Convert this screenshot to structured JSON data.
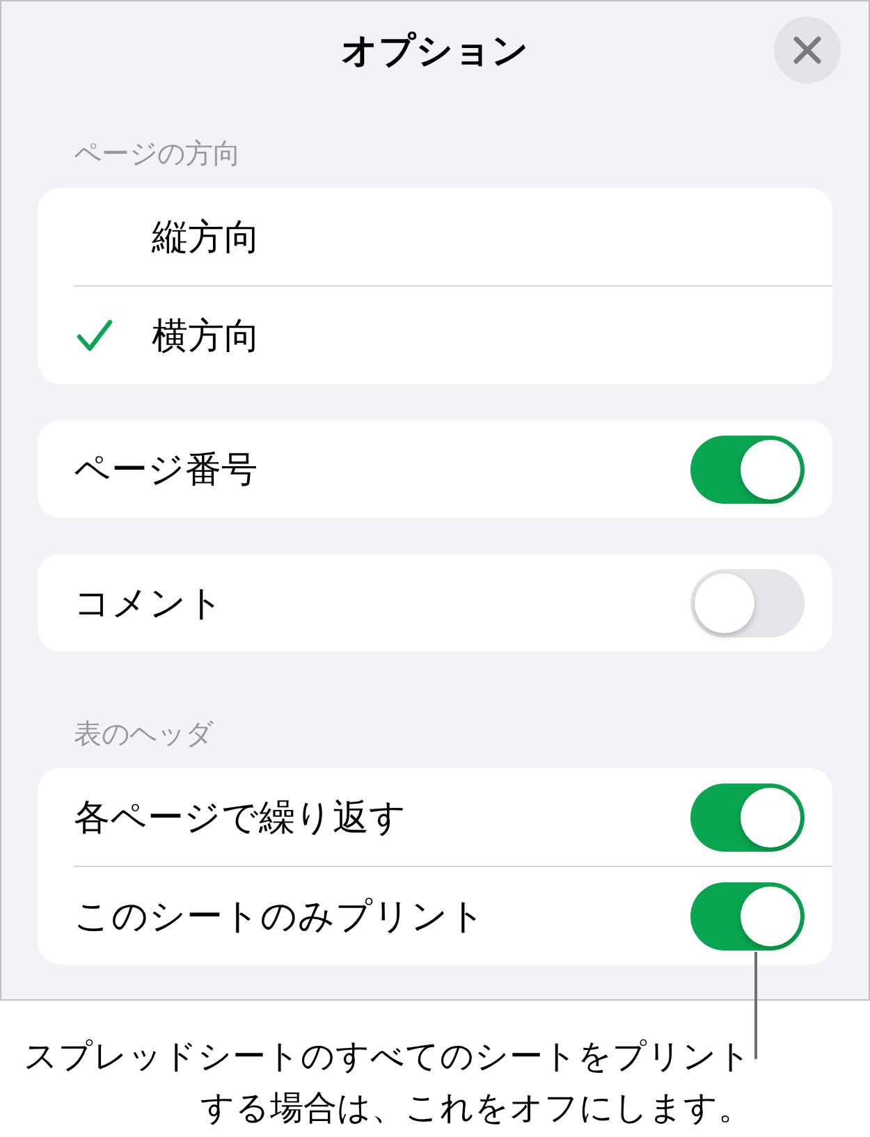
{
  "dialog": {
    "title": "オプション"
  },
  "sections": [
    {
      "kind": "choice",
      "header": "ページの方向",
      "options": [
        {
          "label": "縦方向",
          "selected": false
        },
        {
          "label": "横方向",
          "selected": true
        }
      ]
    },
    {
      "kind": "toggles",
      "rows": [
        {
          "label": "ページ番号",
          "on": true
        }
      ]
    },
    {
      "kind": "toggles",
      "rows": [
        {
          "label": "コメント",
          "on": false
        }
      ]
    },
    {
      "kind": "toggles",
      "header": "表のヘッダ",
      "rows": [
        {
          "label": "各ページで繰り返す",
          "on": true
        },
        {
          "label": "このシートのみプリント",
          "on": true
        }
      ]
    }
  ],
  "callout": {
    "text": "スプレッドシートのすべてのシートをプリントする場合は、これをオフにします。"
  }
}
